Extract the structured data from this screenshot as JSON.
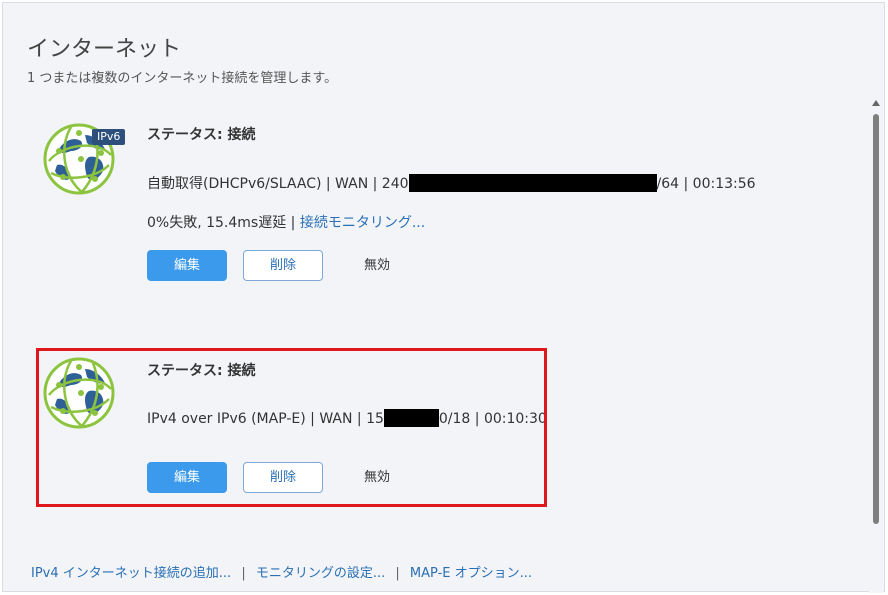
{
  "header": {
    "title": "インターネット",
    "subtitle": "1 つまたは複数のインターネット接続を管理します。"
  },
  "connections": [
    {
      "badge": "IPv6",
      "status": "ステータス: 接続",
      "detail_prefix": "自動取得(DHCPv6/SLAAC) | WAN | 240",
      "detail_suffix": "/64 | 00:13:56",
      "stats": "0%失敗, 15.4ms遅延 | ",
      "monitor_link": "接続モニタリング...",
      "edit_label": "編集",
      "delete_label": "削除",
      "disable_label": "無効"
    },
    {
      "status": "ステータス: 接続",
      "detail_prefix": "IPv4 over IPv6 (MAP-E) | WAN | 15",
      "detail_suffix": "0/18 | 00:10:30",
      "edit_label": "編集",
      "delete_label": "削除",
      "disable_label": "無効"
    }
  ],
  "footer": {
    "add_ipv4_link": "IPv4 インターネット接続の追加...",
    "sep1": "|",
    "monitoring_settings_link": "モニタリングの設定...",
    "sep2": "|",
    "mape_options_link": "MAP-E オプション..."
  },
  "colors": {
    "primary_button": "#3b9aec",
    "link": "#2a6fb5",
    "highlight_border": "#e0161d",
    "globe_blue": "#2e5f96",
    "globe_green": "#8cc43f"
  }
}
